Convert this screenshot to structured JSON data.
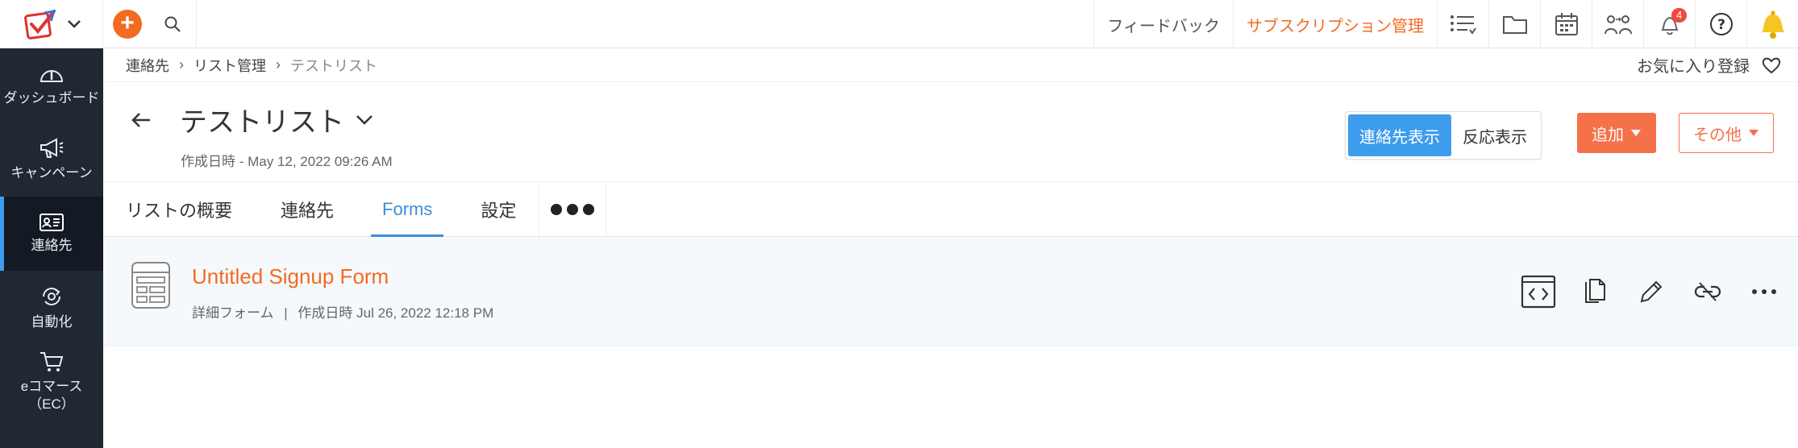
{
  "topbar": {
    "feedback": "フィードバック",
    "subscription": "サブスクリプション管理",
    "notification_count": "4",
    "icons": [
      "logo-icon",
      "chevron-down-icon",
      "plus-icon",
      "search-icon",
      "list-icon",
      "folder-icon",
      "calendar-icon",
      "users-icon",
      "bell-icon",
      "help-icon",
      "bell-gold-icon"
    ]
  },
  "sidebar": {
    "items": [
      {
        "label": "ダッシュボード",
        "icon": "gauge-icon"
      },
      {
        "label": "キャンペーン",
        "icon": "megaphone-icon"
      },
      {
        "label": "連絡先",
        "icon": "contact-card-icon"
      },
      {
        "label": "自動化",
        "icon": "automation-icon"
      },
      {
        "label": "eコマース（EC）",
        "icon": "cart-icon"
      }
    ]
  },
  "breadcrumb": {
    "items": [
      "連絡先",
      "リスト管理",
      "テストリスト"
    ],
    "favorite": "お気に入り登録"
  },
  "header": {
    "title": "テストリスト",
    "created": "作成日時 - May 12, 2022 09:26 AM",
    "toggle": [
      "連絡先表示",
      "反応表示"
    ],
    "add": "追加",
    "more": "その他"
  },
  "tabs": [
    "リストの概要",
    "連絡先",
    "Forms",
    "設定"
  ],
  "form": {
    "name": "Untitled Signup Form",
    "type": "詳細フォーム",
    "separator": "|",
    "created": "作成日時 Jul 26, 2022 12:18 PM",
    "actions": [
      "embed-code-icon",
      "copy-icon",
      "edit-icon",
      "unlink-icon",
      "more-icon"
    ]
  },
  "colors": {
    "accent": "#f26b21",
    "primary": "#3d9cec",
    "sidebar": "#1f2833"
  }
}
